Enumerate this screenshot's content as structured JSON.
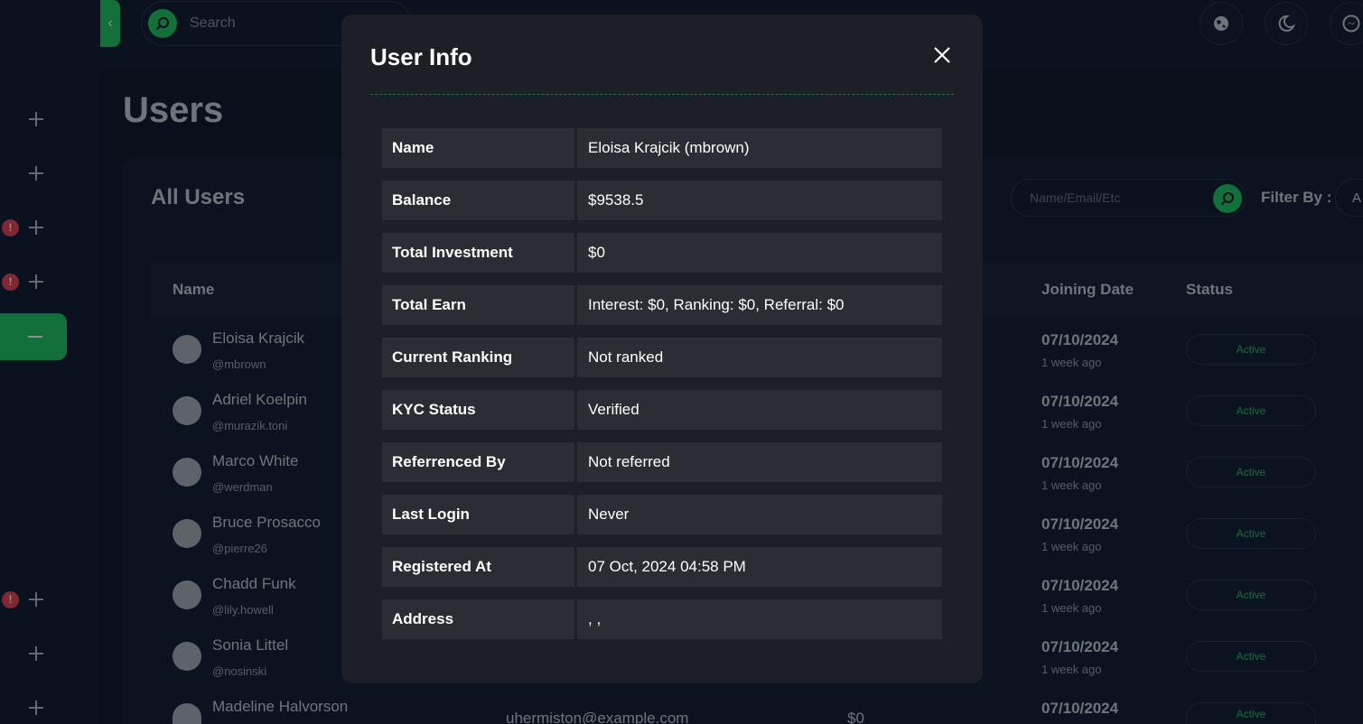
{
  "topbar": {
    "search_placeholder": "Search"
  },
  "page": {
    "title": "Users"
  },
  "card": {
    "title": "All Users",
    "filter_placeholder": "Name/Email/Etc",
    "filter_label": "Filter By :",
    "filter_value": "A"
  },
  "table": {
    "headers": {
      "name": "Name",
      "joining_date": "Joining Date",
      "status": "Status"
    },
    "rows": [
      {
        "name": "Eloisa Krajcik",
        "handle": "@mbrown",
        "date": "07/10/2024",
        "ago": "1 week ago",
        "status": "Active"
      },
      {
        "name": "Adriel Koelpin",
        "handle": "@murazik.toni",
        "date": "07/10/2024",
        "ago": "1 week ago",
        "status": "Active"
      },
      {
        "name": "Marco White",
        "handle": "@werdman",
        "date": "07/10/2024",
        "ago": "1 week ago",
        "status": "Active"
      },
      {
        "name": "Bruce Prosacco",
        "handle": "@pierre26",
        "date": "07/10/2024",
        "ago": "1 week ago",
        "status": "Active"
      },
      {
        "name": "Chadd Funk",
        "handle": "@lily.howell",
        "date": "07/10/2024",
        "ago": "1 week ago",
        "status": "Active"
      },
      {
        "name": "Sonia Littel",
        "handle": "@nosinski",
        "date": "07/10/2024",
        "ago": "1 week ago",
        "status": "Active"
      },
      {
        "name": "Madeline Halvorson",
        "email": "uhermiston@example.com",
        "balance": "$0",
        "date": "07/10/2024",
        "status": "Active"
      }
    ]
  },
  "sidebar": {
    "alert_symbol": "!"
  },
  "modal": {
    "title": "User Info",
    "rows": [
      {
        "label": "Name",
        "value": "Eloisa Krajcik (mbrown)"
      },
      {
        "label": "Balance",
        "value": "$9538.5"
      },
      {
        "label": "Total Investment",
        "value": "$0"
      },
      {
        "label": "Total Earn",
        "value": "Interest: $0, Ranking: $0, Referral: $0"
      },
      {
        "label": "Current Ranking",
        "value": "Not ranked"
      },
      {
        "label": "KYC Status",
        "value": "Verified"
      },
      {
        "label": "Referrenced By",
        "value": "Not referred"
      },
      {
        "label": "Last Login",
        "value": "Never"
      },
      {
        "label": "Registered At",
        "value": "07 Oct, 2024 04:58 PM"
      },
      {
        "label": "Address",
        "value": ", ,"
      }
    ]
  },
  "colors": {
    "accent": "#22c55e",
    "background": "#0f1626",
    "modal_bg": "#1c1f25",
    "alert": "#e0424f"
  },
  "icons": {
    "search": "search-icon",
    "globe": "globe-icon",
    "theme": "moon-icon",
    "messenger": "messenger-icon",
    "close": "close-icon",
    "collapse": "chevron-left-icon"
  }
}
